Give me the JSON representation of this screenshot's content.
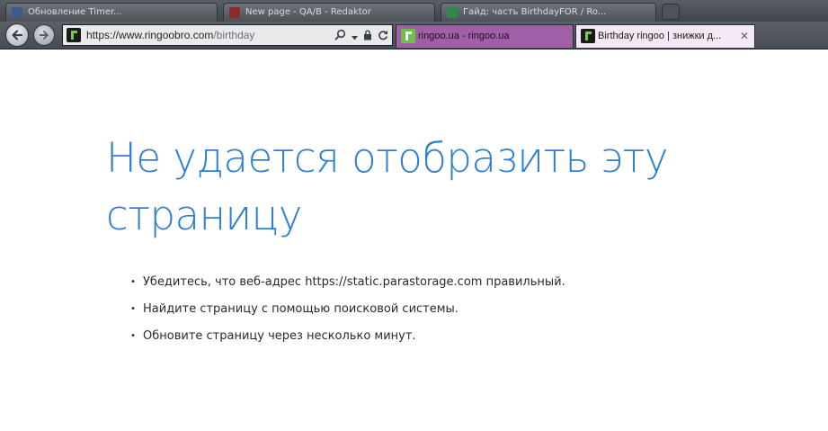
{
  "taskbar": {
    "items": [
      {
        "label": "Обновление Timer..."
      },
      {
        "label": "New page - QA/B - Redaktor"
      },
      {
        "label": "Гайд: часть BirthdayFOR / Ro..."
      }
    ]
  },
  "browser": {
    "address": {
      "scheme": "https://",
      "host": "www.ringoobro.com",
      "path": "/birthday"
    },
    "tabs": [
      {
        "label": "ringoo.ua - ringoo.ua"
      },
      {
        "label": "Birthday ringoo | знижки д..."
      }
    ],
    "close_glyph": "✕"
  },
  "page": {
    "title": "Не удается отобразить эту страницу",
    "suggestions": [
      "Убедитесь, что веб-адрес https://static.parastorage.com правильный.",
      "Найдите страницу с помощью поисковой системы.",
      "Обновите страницу через несколько минут."
    ],
    "bullet": "•"
  },
  "colors": {
    "title_blue": "#2d7fd8",
    "active_tab": "#f3e8f3",
    "inactive_tab": "#a05fa6",
    "brand_green": "#7ac943"
  },
  "icons": [
    "back-arrow-icon",
    "forward-arrow-icon",
    "search-icon",
    "dropdown-icon",
    "lock-icon",
    "refresh-icon",
    "close-icon"
  ]
}
